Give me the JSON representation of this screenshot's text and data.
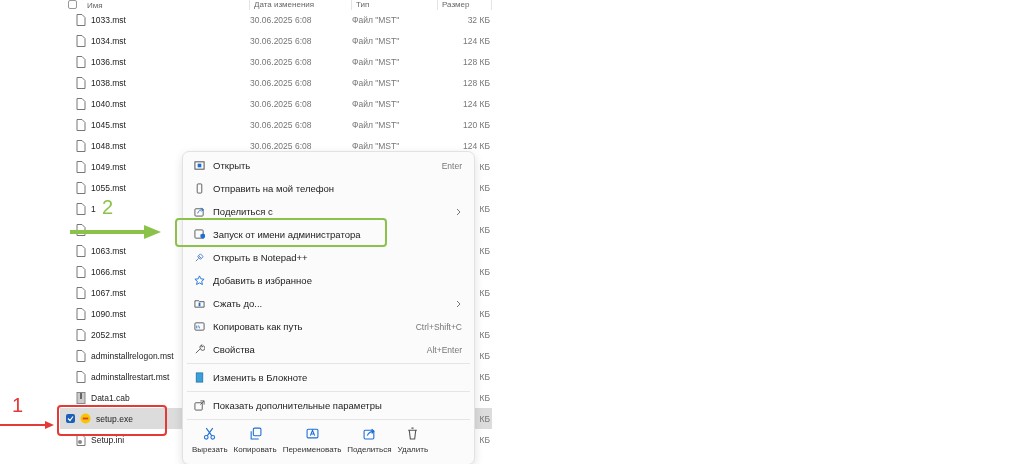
{
  "columns": [
    {
      "label": "Имя"
    },
    {
      "label": "Дата изменения"
    },
    {
      "label": "Тип"
    },
    {
      "label": "Размер"
    }
  ],
  "files": [
    {
      "name": "1033.mst",
      "kind": "file",
      "date": "30.06.2025 6:08",
      "type": "Файл \"MST\"",
      "size": "32 КБ",
      "selected": false
    },
    {
      "name": "1034.mst",
      "kind": "file",
      "date": "30.06.2025 6:08",
      "type": "Файл \"MST\"",
      "size": "124 КБ",
      "selected": false
    },
    {
      "name": "1036.mst",
      "kind": "file",
      "date": "30.06.2025 6:08",
      "type": "Файл \"MST\"",
      "size": "128 КБ",
      "selected": false
    },
    {
      "name": "1038.mst",
      "kind": "file",
      "date": "30.06.2025 6:08",
      "type": "Файл \"MST\"",
      "size": "128 КБ",
      "selected": false
    },
    {
      "name": "1040.mst",
      "kind": "file",
      "date": "30.06.2025 6:08",
      "type": "Файл \"MST\"",
      "size": "124 КБ",
      "selected": false
    },
    {
      "name": "1045.mst",
      "kind": "file",
      "date": "30.06.2025 6:08",
      "type": "Файл \"MST\"",
      "size": "120 КБ",
      "selected": false
    },
    {
      "name": "1048.mst",
      "kind": "file",
      "date": "30.06.2025 6:08",
      "type": "Файл \"MST\"",
      "size": "124 КБ",
      "selected": false
    },
    {
      "name": "1049.mst",
      "kind": "file",
      "size": "КБ",
      "selected": false
    },
    {
      "name": "1055.mst",
      "kind": "file",
      "size": "КБ",
      "selected": false
    },
    {
      "name": "1",
      "kind": "file",
      "size": "КБ",
      "selected": false
    },
    {
      "kind": "file",
      "size": "КБ",
      "selected": false
    },
    {
      "name": "1063.mst",
      "kind": "file",
      "size": "КБ",
      "selected": false
    },
    {
      "name": "1066.mst",
      "kind": "file",
      "size": "КБ",
      "selected": false
    },
    {
      "name": "1067.mst",
      "kind": "file",
      "size": "КБ",
      "selected": false
    },
    {
      "name": "1090.mst",
      "kind": "file",
      "size": "КБ",
      "selected": false
    },
    {
      "name": "2052.mst",
      "kind": "file",
      "size": "КБ",
      "selected": false
    },
    {
      "name": "adminstallrelogon.mst",
      "kind": "file",
      "size": "КБ",
      "selected": false
    },
    {
      "name": "adminstallrestart.mst",
      "kind": "file",
      "size": "КБ",
      "selected": false
    },
    {
      "name": "Data1.cab",
      "kind": "archive",
      "size": "КБ",
      "selected": false
    },
    {
      "name": "setup.exe",
      "kind": "setup",
      "size": "КБ",
      "selected": true
    },
    {
      "name": "Setup.ini",
      "kind": "config",
      "size": "КБ",
      "selected": false
    }
  ],
  "all_checked": false,
  "context_menu": {
    "groups": [
      [
        {
          "label": "Открыть",
          "shortcut": "Enter",
          "submenu": false
        },
        {
          "label": "Отправить на мой телефон",
          "submenu": false
        },
        {
          "label": "Поделиться с",
          "submenu": true
        },
        {
          "label": "Запуск от имени администратора",
          "submenu": false
        },
        {
          "label": "Открыть в Notepad++",
          "submenu": false
        },
        {
          "label": "Добавить в избранное",
          "submenu": false
        },
        {
          "label": "Сжать до...",
          "submenu": true
        },
        {
          "label": "Копировать как путь",
          "shortcut": "Ctrl+Shift+C",
          "submenu": false
        },
        {
          "label": "Свойства",
          "shortcut": "Alt+Enter",
          "submenu": false
        }
      ],
      [
        {
          "label": "Изменить в Блокноте",
          "submenu": false
        }
      ],
      [
        {
          "label": "Показать дополнительные параметры",
          "submenu": false
        }
      ]
    ],
    "actions": [
      {
        "label": "Вырезать"
      },
      {
        "label": "Копировать"
      },
      {
        "label": "Переименовать"
      },
      {
        "label": "Поделиться"
      },
      {
        "label": "Удалить"
      }
    ]
  },
  "annotations": [
    {
      "number": "1",
      "color": "#e53935"
    },
    {
      "number": "2",
      "color": "#8bc34a"
    }
  ]
}
